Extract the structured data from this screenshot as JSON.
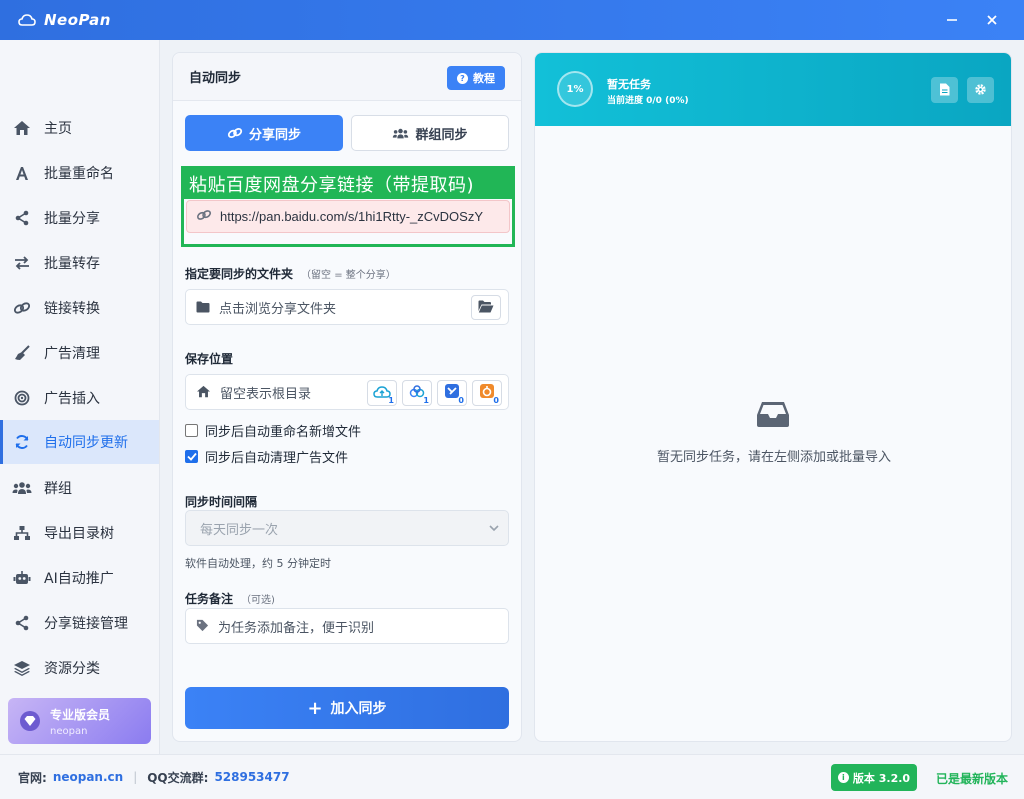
{
  "app": {
    "name": "NeoPan"
  },
  "sidebar": {
    "items": [
      {
        "label": "主页",
        "icon": "home-icon"
      },
      {
        "label": "批量重命名",
        "icon": "font-a-icon"
      },
      {
        "label": "批量分享",
        "icon": "share-nodes-icon"
      },
      {
        "label": "批量转存",
        "icon": "transfer-arrows-icon"
      },
      {
        "label": "链接转换",
        "icon": "link-icon"
      },
      {
        "label": "广告清理",
        "icon": "broom-icon"
      },
      {
        "label": "广告插入",
        "icon": "target-icon"
      },
      {
        "label": "自动同步更新",
        "icon": "sync-icon",
        "active": true
      },
      {
        "label": "群组",
        "icon": "users-icon"
      },
      {
        "label": "导出目录树",
        "icon": "sitemap-icon"
      },
      {
        "label": "AI自动推广",
        "icon": "robot-icon"
      },
      {
        "label": "分享链接管理",
        "icon": "share-nodes-icon"
      },
      {
        "label": "资源分类",
        "icon": "layers-icon"
      }
    ],
    "pro": {
      "title": "专业版会员",
      "user": "neopan"
    }
  },
  "form": {
    "title": "自动同步",
    "tutorial_label": "教程",
    "tabs": [
      {
        "label": "分享同步",
        "active": true
      },
      {
        "label": "群组同步",
        "active": false
      }
    ],
    "link_caption": "粘贴百度网盘分享链接（带提取码)",
    "link_value": "https://pan.baidu.com/s/1hi1Rtty-_zCvDOSzY",
    "folder_label": "指定要同步的文件夹",
    "folder_hint": "（留空 = 整个分享）",
    "folder_placeholder": "点击浏览分享文件夹",
    "save_label": "保存位置",
    "save_placeholder": "留空表示根目录",
    "cloud_badges": [
      "1",
      "1",
      "0",
      "0"
    ],
    "checkboxes": [
      {
        "label": "同步后自动重命名新增文件",
        "checked": false
      },
      {
        "label": "同步后自动清理广告文件",
        "checked": true
      }
    ],
    "interval_label": "同步时间间隔",
    "interval_value": "每天同步一次",
    "interval_helper": "软件自动处理，约 5 分钟定时",
    "note_label": "任务备注",
    "note_hint": "（可选)",
    "note_placeholder": "为任务添加备注，便于识别",
    "submit_label": "加入同步"
  },
  "tasks": {
    "percent": "1%",
    "status": "暂无任务",
    "progress_text": "当前进度 0/0 (0%)",
    "empty_text": "暂无同步任务，请在左侧添加或批量导入"
  },
  "footer": {
    "site_label": "官网:",
    "site_value": "neopan.cn",
    "qq_label": "QQ交流群:",
    "qq_value": "528953477",
    "version_label": "版本 3.2.0",
    "latest_label": "已是最新版本"
  },
  "colors": {
    "accent": "#3b82f6",
    "header": "#2f6fe0",
    "task_header": "#12c0d8",
    "success": "#22b45a"
  }
}
